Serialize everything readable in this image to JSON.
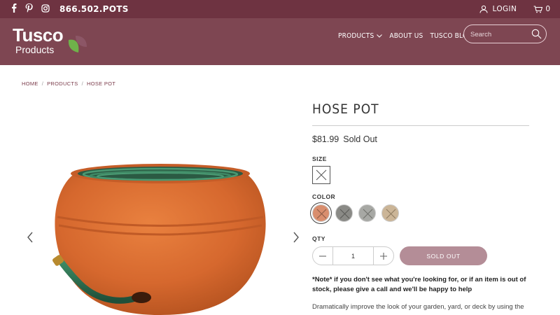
{
  "topbar": {
    "phone": "866.502.POTS",
    "login_label": "LOGIN",
    "cart_count": "0",
    "social_icons": [
      "facebook-icon",
      "pinterest-icon",
      "instagram-icon"
    ]
  },
  "header": {
    "logo_brand": "Tusco",
    "logo_sub": "Products",
    "nav": [
      {
        "label": "PRODUCTS",
        "has_dropdown": true
      },
      {
        "label": "ABOUT US"
      },
      {
        "label": "TUSCO BLOGS"
      }
    ],
    "search_placeholder": "Search"
  },
  "breadcrumb": {
    "items": [
      "HOME",
      "PRODUCTS",
      "HOSE POT"
    ],
    "separator": "/"
  },
  "product": {
    "title": "HOSE POT",
    "price": "$81.99",
    "availability": "Sold Out",
    "size_label": "SIZE",
    "color_label": "COLOR",
    "qty_label": "QTY",
    "quantity": "1",
    "sold_out_button": "SOLD OUT",
    "note": "*Note* if you don't see what you're looking for, or if an item is out of stock, please give a call and we'll be happy to help",
    "description": "Dramatically improve the look of your garden, yard, or deck by using the",
    "color_swatches": [
      {
        "name": "terracotta",
        "color": "#d98e6e",
        "selected": true
      },
      {
        "name": "gray",
        "color": "#8a8a86",
        "selected": false
      },
      {
        "name": "stone",
        "color": "#a7a8a4",
        "selected": false
      },
      {
        "name": "sand",
        "color": "#cbb597",
        "selected": false
      }
    ]
  },
  "colors": {
    "topbar": "#6e3341",
    "header": "#7e4652",
    "accent": "#7a3b4a",
    "sold_out_button": "#b48d97",
    "pot": "#d6682e",
    "hose": "#2f6b4f"
  }
}
